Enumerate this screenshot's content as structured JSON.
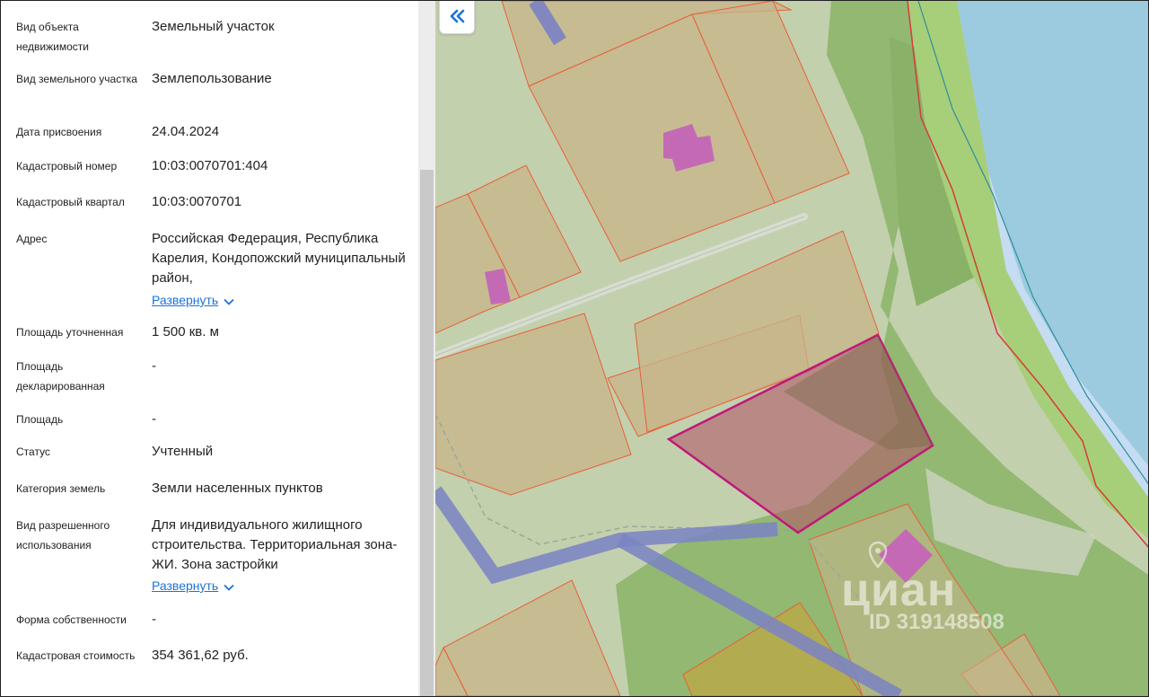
{
  "fields": [
    {
      "label": "Вид объекта недвижимости",
      "value": "Земельный участок"
    },
    {
      "label": "Вид земельного участка",
      "value": "Землепользование"
    },
    {
      "label": "Дата присвоения",
      "value": "24.04.2024"
    },
    {
      "label": "Кадастровый номер",
      "value": "10:03:0070701:404"
    },
    {
      "label": "Кадастровый квартал",
      "value": "10:03:0070701"
    },
    {
      "label": "Адрес",
      "value": "Российская Федерация, Республика Карелия, Кондопожский муниципальный район,",
      "expand_label": "Развернуть"
    },
    {
      "label": "Площадь уточненная",
      "value": "1 500 кв. м"
    },
    {
      "label": "Площадь декларированная",
      "value": "-"
    },
    {
      "label": "Площадь",
      "value": "-"
    },
    {
      "label": "Статус",
      "value": "Учтенный"
    },
    {
      "label": "Категория земель",
      "value": "Земли населенных пунктов"
    },
    {
      "label": "Вид разрешенного использования",
      "value": "Для индивидуального жилищного строительства. Территориальная зона- ЖИ. Зона застройки",
      "expand_label": "Развернуть"
    },
    {
      "label": "Форма собственности",
      "value": "-"
    },
    {
      "label": "Кадастровая стоимость",
      "value": "354 361,62 руб."
    }
  ],
  "map": {
    "collapse_icon": "chevrons-left-icon",
    "watermark_brand": "циан",
    "watermark_id": "ID 319148508"
  },
  "colors": {
    "link": "#1a73d9",
    "water": "#9ccbe0",
    "selected_parcel": "#c0387a",
    "boundary": "#e8603a"
  }
}
